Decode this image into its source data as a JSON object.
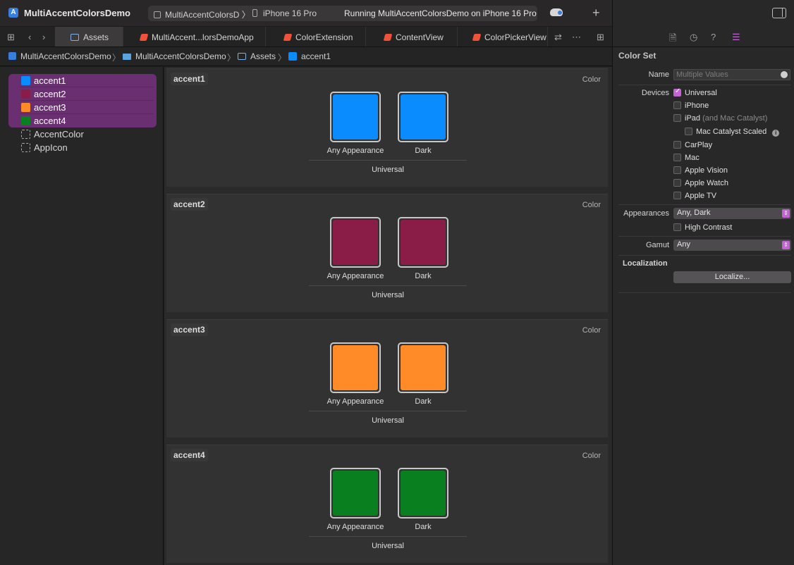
{
  "titlebar": {
    "app_title": "MultiAccentColorsDemo",
    "scheme_name": "MultiAccentColorsD",
    "device": "iPhone 16 Pro",
    "status": "Running MultiAccentColorsDemo on iPhone 16 Pro"
  },
  "tabs": [
    {
      "label": "Assets",
      "icon": "asset-catalog-icon",
      "active": true
    },
    {
      "label": "MultiAccent...lorsDemoApp",
      "icon": "swift-file-icon",
      "active": false
    },
    {
      "label": "ColorExtension",
      "icon": "swift-file-icon",
      "active": false
    },
    {
      "label": "ContentView",
      "icon": "swift-file-icon",
      "active": false
    },
    {
      "label": "ColorPickerView",
      "icon": "swift-file-icon",
      "active": false
    }
  ],
  "breadcrumb": [
    "MultiAccentColorsDemo",
    "MultiAccentColorsDemo",
    "Assets",
    "accent1"
  ],
  "sidebar": {
    "items": [
      {
        "label": "accent1",
        "color": "#0a8cff",
        "selected": true
      },
      {
        "label": "accent2",
        "color": "#8a1d48",
        "selected": true
      },
      {
        "label": "accent3",
        "color": "#ff8a28",
        "selected": true
      },
      {
        "label": "accent4",
        "color": "#0a7f20",
        "selected": true
      },
      {
        "label": "AccentColor",
        "color": null,
        "selected": false
      },
      {
        "label": "AppIcon",
        "color": null,
        "selected": false
      }
    ]
  },
  "colorsets": [
    {
      "name": "accent1",
      "type": "Color",
      "any_color": "#0a8cff",
      "dark_color": "#0a8cff",
      "any_label": "Any Appearance",
      "dark_label": "Dark",
      "group_label": "Universal"
    },
    {
      "name": "accent2",
      "type": "Color",
      "any_color": "#8a1d48",
      "dark_color": "#8a1d48",
      "any_label": "Any Appearance",
      "dark_label": "Dark",
      "group_label": "Universal"
    },
    {
      "name": "accent3",
      "type": "Color",
      "any_color": "#ff8a28",
      "dark_color": "#ff8a28",
      "any_label": "Any Appearance",
      "dark_label": "Dark",
      "group_label": "Universal"
    },
    {
      "name": "accent4",
      "type": "Color",
      "any_color": "#0a7f20",
      "dark_color": "#0a7f20",
      "any_label": "Any Appearance",
      "dark_label": "Dark",
      "group_label": "Universal"
    }
  ],
  "inspector": {
    "section_title": "Color Set",
    "name_label": "Name",
    "name_placeholder": "Multiple Values",
    "devices_label": "Devices",
    "devices": [
      {
        "label": "Universal",
        "checked": true
      },
      {
        "label": "iPhone",
        "checked": false
      },
      {
        "label": "iPad",
        "note": "(and Mac Catalyst)",
        "checked": false
      },
      {
        "label": "Mac Catalyst Scaled",
        "checked": false
      },
      {
        "label": "CarPlay",
        "checked": false
      },
      {
        "label": "Mac",
        "checked": false
      },
      {
        "label": "Apple Vision",
        "checked": false
      },
      {
        "label": "Apple Watch",
        "checked": false
      },
      {
        "label": "Apple TV",
        "checked": false
      }
    ],
    "appearances_label": "Appearances",
    "appearances_value": "Any, Dark",
    "high_contrast_label": "High Contrast",
    "gamut_label": "Gamut",
    "gamut_value": "Any",
    "localization_label": "Localization",
    "localize_button": "Localize..."
  },
  "accent_color": "#c463d4"
}
